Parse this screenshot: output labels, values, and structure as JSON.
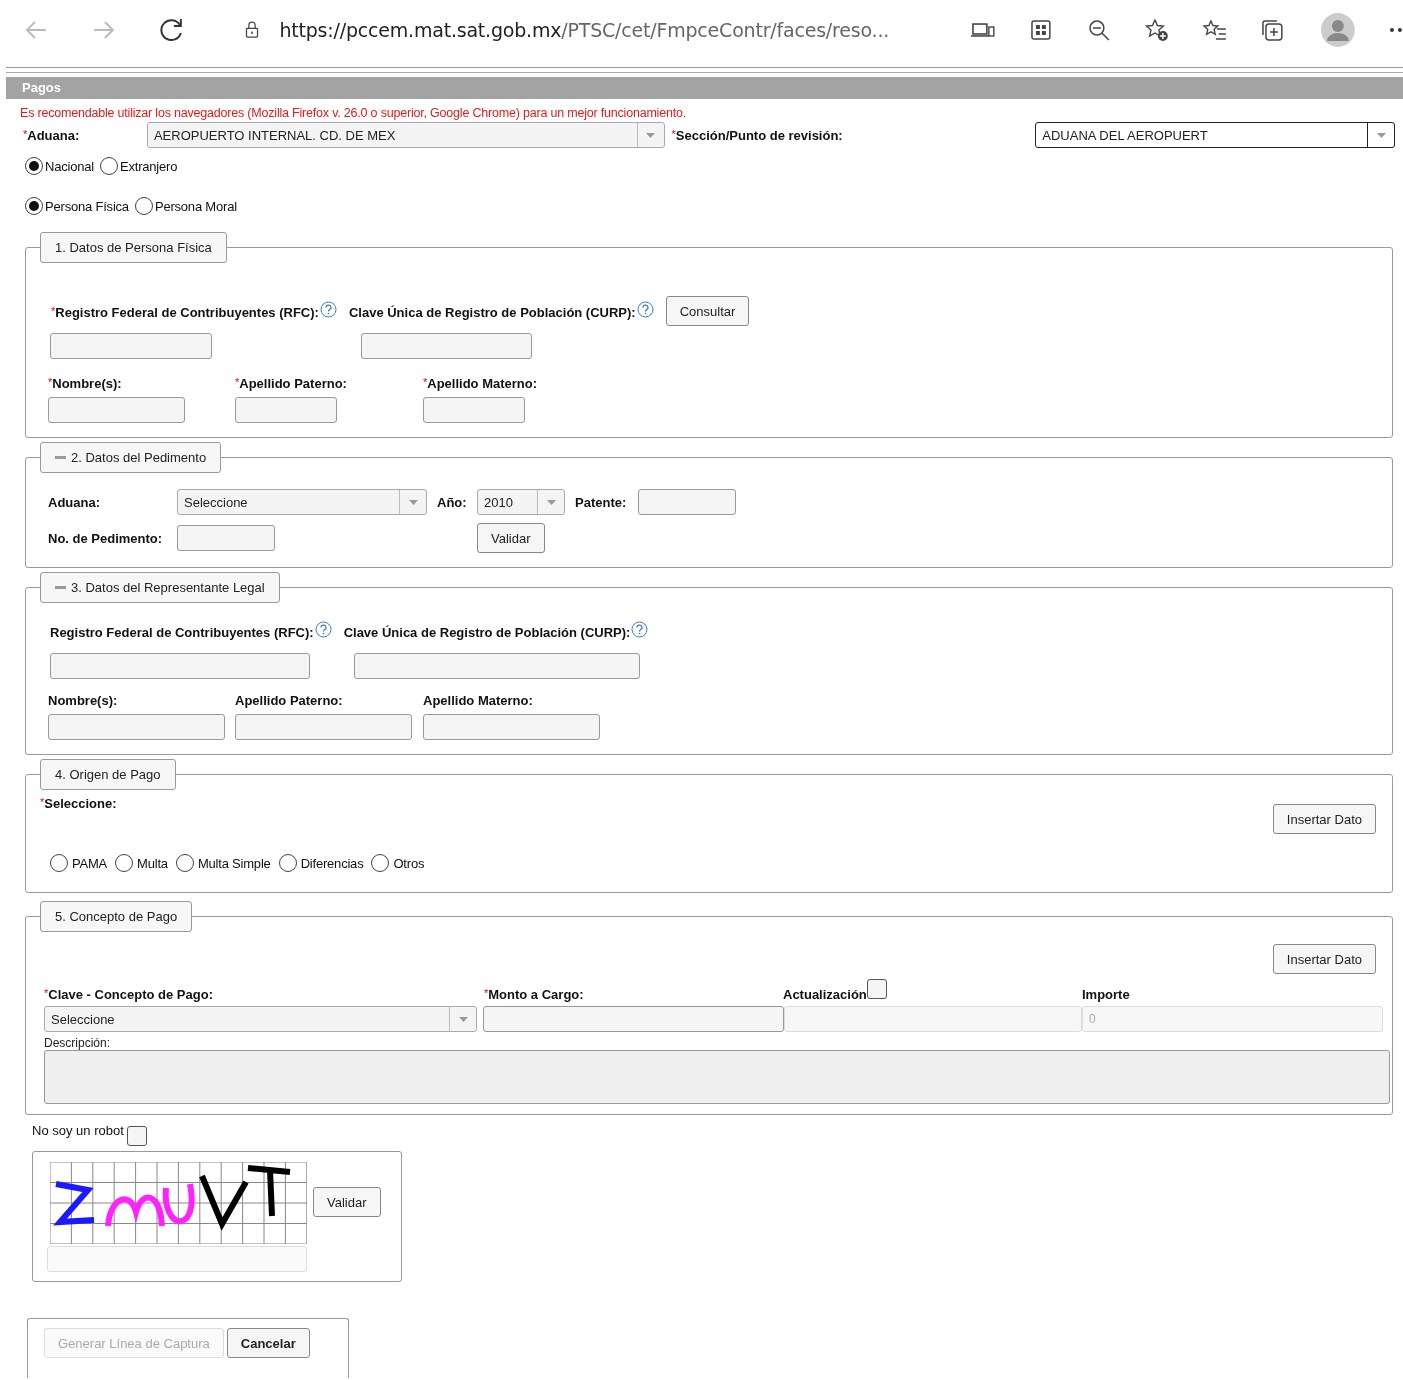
{
  "browser": {
    "url_host": "https://pccem.mat.sat.gob.mx",
    "url_path": "/PTSC/cet/FmpceContr/faces/reso..."
  },
  "header": {
    "title": "Pagos"
  },
  "required_marker": "*",
  "notice": "Es recomendable utilizar los navegadores (Mozilla Firefox v. 26.0 o superior, Google Chrome) para un mejor funcionamiento.",
  "aduana": {
    "label": "Aduana:",
    "required": true,
    "value": "AEROPUERTO INTERNAL. CD. DE MEX",
    "disabled": true
  },
  "seccion": {
    "label": "Sección/Punto de revisión:",
    "required": true,
    "value": "ADUANA DEL AEROPUERT",
    "disabled": false
  },
  "origin_radios": [
    {
      "label": "Nacional",
      "selected": true
    },
    {
      "label": "Extranjero",
      "selected": false
    }
  ],
  "person_radios": [
    {
      "label": "Persona Física",
      "selected": true
    },
    {
      "label": "Persona Moral",
      "selected": false
    }
  ],
  "persona": {
    "legend": "1. Datos de Persona Física",
    "collapsible": false,
    "id_fields": [
      {
        "label": "Registro Federal de Contribuyentes (RFC):",
        "required": true,
        "help": true
      },
      {
        "label": "Clave Única de Registro de Población (CURP):",
        "required": false,
        "help": true
      }
    ],
    "button": "Consultar",
    "name_fields": [
      {
        "label": "Nombre(s):",
        "required": true
      },
      {
        "label": "Apellido Paterno:",
        "required": true
      },
      {
        "label": "Apellido Materno:",
        "required": true
      }
    ]
  },
  "pedimento": {
    "legend": "2. Datos del Pedimento",
    "collapsible": true,
    "aduana": {
      "label": "Aduana:",
      "value": "Seleccione"
    },
    "anio": {
      "label": "Año:",
      "value": "2010"
    },
    "patente": {
      "label": "Patente:"
    },
    "numero": {
      "label": "No. de Pedimento:"
    },
    "button": "Validar"
  },
  "representante": {
    "legend": "3. Datos del Representante Legal",
    "collapsible": true,
    "id_fields": [
      {
        "label": "Registro Federal de Contribuyentes (RFC):",
        "required": false,
        "help": true
      },
      {
        "label": "Clave Única de Registro de Población (CURP):",
        "required": false,
        "help": true
      }
    ],
    "name_fields": [
      {
        "label": "Nombre(s):",
        "required": false
      },
      {
        "label": "Apellido Paterno:",
        "required": false
      },
      {
        "label": "Apellido Materno:",
        "required": false
      }
    ]
  },
  "origen": {
    "legend": "4. Origen de Pago",
    "collapsible": false,
    "label": "Seleccione:",
    "required": true,
    "button": "Insertar Dato",
    "options": [
      {
        "label": "PAMA",
        "selected": false
      },
      {
        "label": "Multa",
        "selected": false
      },
      {
        "label": "Multa Simple",
        "selected": false
      },
      {
        "label": "Diferencias",
        "selected": false
      },
      {
        "label": "Otros",
        "selected": false
      }
    ]
  },
  "concepto": {
    "legend": "5. Concepto de Pago",
    "collapsible": false,
    "button": "Insertar Dato",
    "clave": {
      "label": "Clave - Concepto de Pago:",
      "required": true,
      "value": "Seleccione"
    },
    "monto": {
      "label": "Monto a Cargo:",
      "required": true
    },
    "actualizacion": {
      "label": "Actualización",
      "checked": false
    },
    "importe": {
      "label": "Importe",
      "value": "0",
      "disabled": true
    },
    "descripcion": {
      "label": "Descripción:"
    }
  },
  "robot": {
    "label": "No soy un robot",
    "checked": false
  },
  "captcha": {
    "button": "Validar"
  },
  "actions": [
    {
      "label": "Generar Línea de Captura",
      "disabled": true
    },
    {
      "label": "Cancelar",
      "disabled": false
    }
  ]
}
